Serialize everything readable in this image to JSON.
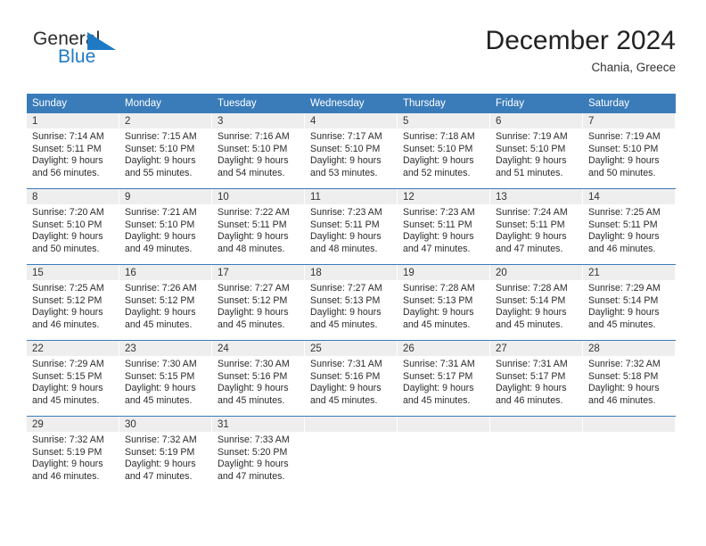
{
  "brand": {
    "name_top": "General",
    "name_bottom": "Blue",
    "flag_icon": "blue-flag-triangle",
    "color_top": "#2b2b2b",
    "color_bottom": "#1f7ac4"
  },
  "header": {
    "title": "December 2024",
    "subtitle": "Chania, Greece"
  },
  "theme": {
    "header_bar": "#3a7cba",
    "daynum_band": "#eeeeee",
    "rule": "#3a7cba"
  },
  "weekdays": [
    "Sunday",
    "Monday",
    "Tuesday",
    "Wednesday",
    "Thursday",
    "Friday",
    "Saturday"
  ],
  "weeks": [
    [
      {
        "day": "1",
        "sunrise": "Sunrise: 7:14 AM",
        "sunset": "Sunset: 5:11 PM",
        "daylight1": "Daylight: 9 hours",
        "daylight2": "and 56 minutes."
      },
      {
        "day": "2",
        "sunrise": "Sunrise: 7:15 AM",
        "sunset": "Sunset: 5:10 PM",
        "daylight1": "Daylight: 9 hours",
        "daylight2": "and 55 minutes."
      },
      {
        "day": "3",
        "sunrise": "Sunrise: 7:16 AM",
        "sunset": "Sunset: 5:10 PM",
        "daylight1": "Daylight: 9 hours",
        "daylight2": "and 54 minutes."
      },
      {
        "day": "4",
        "sunrise": "Sunrise: 7:17 AM",
        "sunset": "Sunset: 5:10 PM",
        "daylight1": "Daylight: 9 hours",
        "daylight2": "and 53 minutes."
      },
      {
        "day": "5",
        "sunrise": "Sunrise: 7:18 AM",
        "sunset": "Sunset: 5:10 PM",
        "daylight1": "Daylight: 9 hours",
        "daylight2": "and 52 minutes."
      },
      {
        "day": "6",
        "sunrise": "Sunrise: 7:19 AM",
        "sunset": "Sunset: 5:10 PM",
        "daylight1": "Daylight: 9 hours",
        "daylight2": "and 51 minutes."
      },
      {
        "day": "7",
        "sunrise": "Sunrise: 7:19 AM",
        "sunset": "Sunset: 5:10 PM",
        "daylight1": "Daylight: 9 hours",
        "daylight2": "and 50 minutes."
      }
    ],
    [
      {
        "day": "8",
        "sunrise": "Sunrise: 7:20 AM",
        "sunset": "Sunset: 5:10 PM",
        "daylight1": "Daylight: 9 hours",
        "daylight2": "and 50 minutes."
      },
      {
        "day": "9",
        "sunrise": "Sunrise: 7:21 AM",
        "sunset": "Sunset: 5:10 PM",
        "daylight1": "Daylight: 9 hours",
        "daylight2": "and 49 minutes."
      },
      {
        "day": "10",
        "sunrise": "Sunrise: 7:22 AM",
        "sunset": "Sunset: 5:11 PM",
        "daylight1": "Daylight: 9 hours",
        "daylight2": "and 48 minutes."
      },
      {
        "day": "11",
        "sunrise": "Sunrise: 7:23 AM",
        "sunset": "Sunset: 5:11 PM",
        "daylight1": "Daylight: 9 hours",
        "daylight2": "and 48 minutes."
      },
      {
        "day": "12",
        "sunrise": "Sunrise: 7:23 AM",
        "sunset": "Sunset: 5:11 PM",
        "daylight1": "Daylight: 9 hours",
        "daylight2": "and 47 minutes."
      },
      {
        "day": "13",
        "sunrise": "Sunrise: 7:24 AM",
        "sunset": "Sunset: 5:11 PM",
        "daylight1": "Daylight: 9 hours",
        "daylight2": "and 47 minutes."
      },
      {
        "day": "14",
        "sunrise": "Sunrise: 7:25 AM",
        "sunset": "Sunset: 5:11 PM",
        "daylight1": "Daylight: 9 hours",
        "daylight2": "and 46 minutes."
      }
    ],
    [
      {
        "day": "15",
        "sunrise": "Sunrise: 7:25 AM",
        "sunset": "Sunset: 5:12 PM",
        "daylight1": "Daylight: 9 hours",
        "daylight2": "and 46 minutes."
      },
      {
        "day": "16",
        "sunrise": "Sunrise: 7:26 AM",
        "sunset": "Sunset: 5:12 PM",
        "daylight1": "Daylight: 9 hours",
        "daylight2": "and 45 minutes."
      },
      {
        "day": "17",
        "sunrise": "Sunrise: 7:27 AM",
        "sunset": "Sunset: 5:12 PM",
        "daylight1": "Daylight: 9 hours",
        "daylight2": "and 45 minutes."
      },
      {
        "day": "18",
        "sunrise": "Sunrise: 7:27 AM",
        "sunset": "Sunset: 5:13 PM",
        "daylight1": "Daylight: 9 hours",
        "daylight2": "and 45 minutes."
      },
      {
        "day": "19",
        "sunrise": "Sunrise: 7:28 AM",
        "sunset": "Sunset: 5:13 PM",
        "daylight1": "Daylight: 9 hours",
        "daylight2": "and 45 minutes."
      },
      {
        "day": "20",
        "sunrise": "Sunrise: 7:28 AM",
        "sunset": "Sunset: 5:14 PM",
        "daylight1": "Daylight: 9 hours",
        "daylight2": "and 45 minutes."
      },
      {
        "day": "21",
        "sunrise": "Sunrise: 7:29 AM",
        "sunset": "Sunset: 5:14 PM",
        "daylight1": "Daylight: 9 hours",
        "daylight2": "and 45 minutes."
      }
    ],
    [
      {
        "day": "22",
        "sunrise": "Sunrise: 7:29 AM",
        "sunset": "Sunset: 5:15 PM",
        "daylight1": "Daylight: 9 hours",
        "daylight2": "and 45 minutes."
      },
      {
        "day": "23",
        "sunrise": "Sunrise: 7:30 AM",
        "sunset": "Sunset: 5:15 PM",
        "daylight1": "Daylight: 9 hours",
        "daylight2": "and 45 minutes."
      },
      {
        "day": "24",
        "sunrise": "Sunrise: 7:30 AM",
        "sunset": "Sunset: 5:16 PM",
        "daylight1": "Daylight: 9 hours",
        "daylight2": "and 45 minutes."
      },
      {
        "day": "25",
        "sunrise": "Sunrise: 7:31 AM",
        "sunset": "Sunset: 5:16 PM",
        "daylight1": "Daylight: 9 hours",
        "daylight2": "and 45 minutes."
      },
      {
        "day": "26",
        "sunrise": "Sunrise: 7:31 AM",
        "sunset": "Sunset: 5:17 PM",
        "daylight1": "Daylight: 9 hours",
        "daylight2": "and 45 minutes."
      },
      {
        "day": "27",
        "sunrise": "Sunrise: 7:31 AM",
        "sunset": "Sunset: 5:17 PM",
        "daylight1": "Daylight: 9 hours",
        "daylight2": "and 46 minutes."
      },
      {
        "day": "28",
        "sunrise": "Sunrise: 7:32 AM",
        "sunset": "Sunset: 5:18 PM",
        "daylight1": "Daylight: 9 hours",
        "daylight2": "and 46 minutes."
      }
    ],
    [
      {
        "day": "29",
        "sunrise": "Sunrise: 7:32 AM",
        "sunset": "Sunset: 5:19 PM",
        "daylight1": "Daylight: 9 hours",
        "daylight2": "and 46 minutes."
      },
      {
        "day": "30",
        "sunrise": "Sunrise: 7:32 AM",
        "sunset": "Sunset: 5:19 PM",
        "daylight1": "Daylight: 9 hours",
        "daylight2": "and 47 minutes."
      },
      {
        "day": "31",
        "sunrise": "Sunrise: 7:33 AM",
        "sunset": "Sunset: 5:20 PM",
        "daylight1": "Daylight: 9 hours",
        "daylight2": "and 47 minutes."
      },
      {
        "day": "",
        "sunrise": "",
        "sunset": "",
        "daylight1": "",
        "daylight2": ""
      },
      {
        "day": "",
        "sunrise": "",
        "sunset": "",
        "daylight1": "",
        "daylight2": ""
      },
      {
        "day": "",
        "sunrise": "",
        "sunset": "",
        "daylight1": "",
        "daylight2": ""
      },
      {
        "day": "",
        "sunrise": "",
        "sunset": "",
        "daylight1": "",
        "daylight2": ""
      }
    ]
  ]
}
